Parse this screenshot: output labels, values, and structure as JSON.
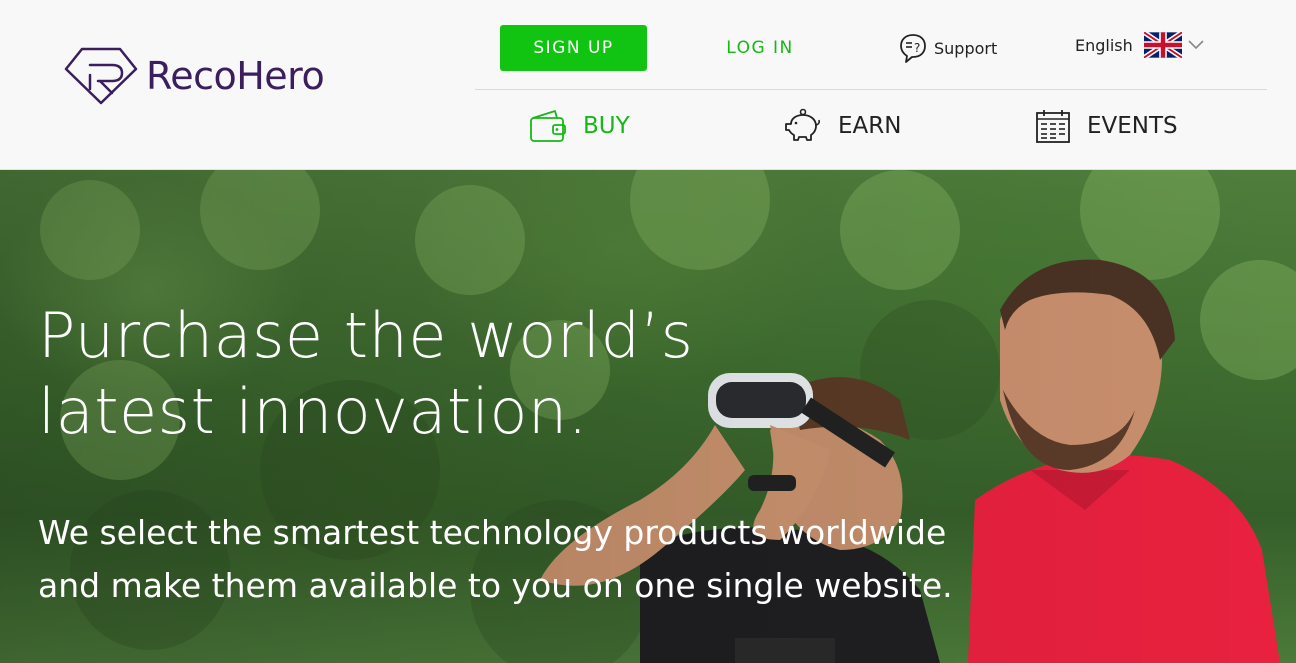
{
  "brand": {
    "name": "RecoHero",
    "logo_icon": "diamond-r-logo",
    "color": "#3a1e5e"
  },
  "topbar": {
    "signup_label": "SIGN UP",
    "login_label": "LOG IN",
    "support_label": "Support",
    "support_icon": "speech-bubble-question-icon",
    "language_label": "English",
    "language_flag": "uk-flag-icon",
    "language_chevron": "chevron-down-icon"
  },
  "nav": {
    "items": [
      {
        "label": "BUY",
        "icon": "wallet-icon",
        "active": true
      },
      {
        "label": "EARN",
        "icon": "piggy-bank-icon",
        "active": false
      },
      {
        "label": "EVENTS",
        "icon": "calendar-icon",
        "active": false
      }
    ]
  },
  "hero": {
    "title": "Purchase the world’s latest innovation.",
    "subtitle": "We select the smartest technology products worldwide and make them available to you on one single website."
  },
  "colors": {
    "accent": "#12c412",
    "text": "#222222",
    "header_bg": "#f8f8f9"
  }
}
